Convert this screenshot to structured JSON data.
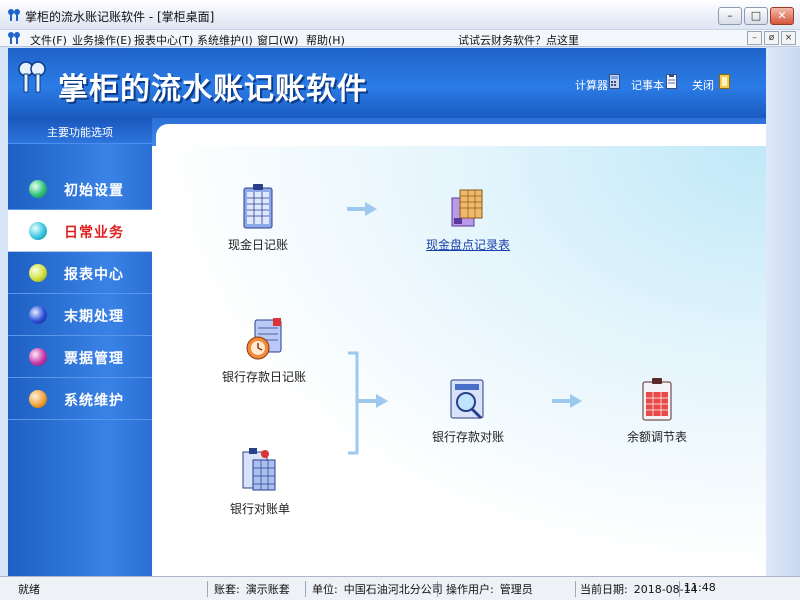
{
  "window": {
    "title": "掌柜的流水账记账软件 - [掌柜桌面]",
    "controls": {
      "minimize": "–",
      "restore": "□",
      "close": "✕"
    }
  },
  "menu": {
    "items": [
      "文件(F)",
      "业务操作(E)",
      "报表中心(T)",
      "系统维护(I)",
      "窗口(W)",
      "帮助(H)"
    ],
    "promo": "试试云财务软件？点这里",
    "mdi": {
      "minimize": "–",
      "restore": "ø",
      "close": "×"
    }
  },
  "banner": {
    "title": "掌柜的流水账记账软件",
    "tools": [
      "计算器",
      "记事本",
      "关闭"
    ]
  },
  "sidebar": {
    "header": "主要功能选项",
    "items": [
      {
        "label": "初始设置",
        "color": "#2fc27a"
      },
      {
        "label": "日常业务",
        "color": "#36c6e0"
      },
      {
        "label": "报表中心",
        "color": "#cfe03a"
      },
      {
        "label": "末期处理",
        "color": "#2a4fd6"
      },
      {
        "label": "票据管理",
        "color": "#c63aa8"
      },
      {
        "label": "系统维护",
        "color": "#f2a235"
      }
    ],
    "active_index": 1
  },
  "modules": {
    "cash_journal": "现金日记账",
    "cash_count": "现金盘点记录表",
    "bank_journal": "银行存款日记账",
    "bank_statement": "银行对账单",
    "bank_reconcile": "银行存款对账",
    "balance_adjust": "余额调节表"
  },
  "status": {
    "ready": "就绪",
    "book_label": "账套:",
    "book_value": "演示账套",
    "unit_label": "单位:",
    "unit_value": "中国石油河北分公司",
    "user_label": "操作用户:",
    "user_value": "管理员",
    "date_label": "当前日期:",
    "date_value": "2018-08-14",
    "time_value": "11:48"
  }
}
